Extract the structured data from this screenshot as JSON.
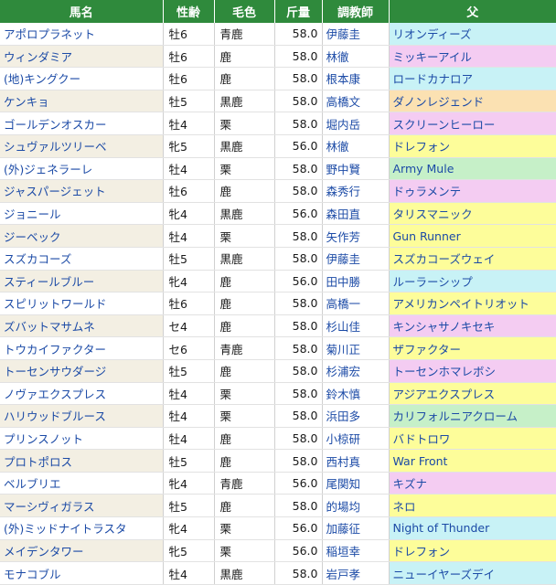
{
  "table": {
    "headers": [
      "馬名",
      "性齢",
      "毛色",
      "斤量",
      "調教師",
      "父"
    ],
    "rows": [
      {
        "name": "アポロプラネット",
        "age": "牡6",
        "coat": "青鹿",
        "weight": "58.0",
        "trainer": "伊藤圭",
        "sire": "リオンディーズ",
        "tone": "cyan"
      },
      {
        "name": "ウィンダミア",
        "age": "牡6",
        "coat": "鹿",
        "weight": "58.0",
        "trainer": "林徹",
        "sire": "ミッキーアイル",
        "tone": "pink"
      },
      {
        "name": "(地)キングクー",
        "age": "牡6",
        "coat": "鹿",
        "weight": "58.0",
        "trainer": "根本康",
        "sire": "ロードカナロア",
        "tone": "cyan"
      },
      {
        "name": "ケンキョ",
        "age": "牡5",
        "coat": "黒鹿",
        "weight": "58.0",
        "trainer": "高橋文",
        "sire": "ダノンレジェンド",
        "tone": "orange"
      },
      {
        "name": "ゴールデンオスカー",
        "age": "牡4",
        "coat": "栗",
        "weight": "58.0",
        "trainer": "堀内岳",
        "sire": "スクリーンヒーロー",
        "tone": "pink"
      },
      {
        "name": "シュヴァルツリーベ",
        "age": "牝5",
        "coat": "黒鹿",
        "weight": "56.0",
        "trainer": "林徹",
        "sire": "ドレフォン",
        "tone": "yellow"
      },
      {
        "name": "(外)ジェネラーレ",
        "age": "牡4",
        "coat": "栗",
        "weight": "58.0",
        "trainer": "野中賢",
        "sire": "Army Mule",
        "tone": "green"
      },
      {
        "name": "ジャスパージェット",
        "age": "牡6",
        "coat": "鹿",
        "weight": "58.0",
        "trainer": "森秀行",
        "sire": "ドゥラメンテ",
        "tone": "pink"
      },
      {
        "name": "ジョニール",
        "age": "牝4",
        "coat": "黒鹿",
        "weight": "56.0",
        "trainer": "森田直",
        "sire": "タリスマニック",
        "tone": "yellow"
      },
      {
        "name": "ジーベック",
        "age": "牡4",
        "coat": "栗",
        "weight": "58.0",
        "trainer": "矢作芳",
        "sire": "Gun Runner",
        "tone": "yellow"
      },
      {
        "name": "スズカコーズ",
        "age": "牡5",
        "coat": "黒鹿",
        "weight": "58.0",
        "trainer": "伊藤圭",
        "sire": "スズカコーズウェイ",
        "tone": "yellow"
      },
      {
        "name": "スティールブルー",
        "age": "牝4",
        "coat": "鹿",
        "weight": "56.0",
        "trainer": "田中勝",
        "sire": "ルーラーシップ",
        "tone": "cyan"
      },
      {
        "name": "スピリットワールド",
        "age": "牡6",
        "coat": "鹿",
        "weight": "58.0",
        "trainer": "高橋一",
        "sire": "アメリカンペイトリオット",
        "tone": "yellow"
      },
      {
        "name": "ズバットマサムネ",
        "age": "セ4",
        "coat": "鹿",
        "weight": "58.0",
        "trainer": "杉山佳",
        "sire": "キンシャサノキセキ",
        "tone": "pink"
      },
      {
        "name": "トウカイファクター",
        "age": "セ6",
        "coat": "青鹿",
        "weight": "58.0",
        "trainer": "菊川正",
        "sire": "ザファクター",
        "tone": "yellow"
      },
      {
        "name": "トーセンサウダージ",
        "age": "牡5",
        "coat": "鹿",
        "weight": "58.0",
        "trainer": "杉浦宏",
        "sire": "トーセンホマレボシ",
        "tone": "pink"
      },
      {
        "name": "ノヴァエクスプレス",
        "age": "牡4",
        "coat": "栗",
        "weight": "58.0",
        "trainer": "鈴木慎",
        "sire": "アジアエクスプレス",
        "tone": "yellow"
      },
      {
        "name": "ハリウッドブルース",
        "age": "牡4",
        "coat": "栗",
        "weight": "58.0",
        "trainer": "浜田多",
        "sire": "カリフォルニアクローム",
        "tone": "green"
      },
      {
        "name": "プリンスノット",
        "age": "牡4",
        "coat": "鹿",
        "weight": "58.0",
        "trainer": "小椋研",
        "sire": "バドトロワ",
        "tone": "yellow"
      },
      {
        "name": "プロトポロス",
        "age": "牡5",
        "coat": "鹿",
        "weight": "58.0",
        "trainer": "西村真",
        "sire": "War Front",
        "tone": "yellow"
      },
      {
        "name": "ベルブリエ",
        "age": "牝4",
        "coat": "青鹿",
        "weight": "56.0",
        "trainer": "尾関知",
        "sire": "キズナ",
        "tone": "pink"
      },
      {
        "name": "マーシヴィガラス",
        "age": "牡5",
        "coat": "鹿",
        "weight": "58.0",
        "trainer": "的場均",
        "sire": "ネロ",
        "tone": "yellow"
      },
      {
        "name": "(外)ミッドナイトラスタ",
        "age": "牝4",
        "coat": "栗",
        "weight": "56.0",
        "trainer": "加藤征",
        "sire": "Night of Thunder",
        "tone": "cyan"
      },
      {
        "name": "メイデンタワー",
        "age": "牝5",
        "coat": "栗",
        "weight": "56.0",
        "trainer": "稲垣幸",
        "sire": "ドレフォン",
        "tone": "yellow"
      },
      {
        "name": "モナコブル",
        "age": "牡4",
        "coat": "黒鹿",
        "weight": "58.0",
        "trainer": "岩戸孝",
        "sire": "ニューイヤーズデイ",
        "tone": "cyan"
      }
    ]
  },
  "colors": {
    "header_bg": "#2f8a3c",
    "link_blue": "#1b4aa6",
    "row_alt": "#f3efe3",
    "sire_cyan": "#c8f2f6",
    "sire_pink": "#f4ccf2",
    "sire_orange": "#fbe1b2",
    "sire_yellow": "#fdfd9a",
    "sire_green": "#c6f0c8"
  }
}
